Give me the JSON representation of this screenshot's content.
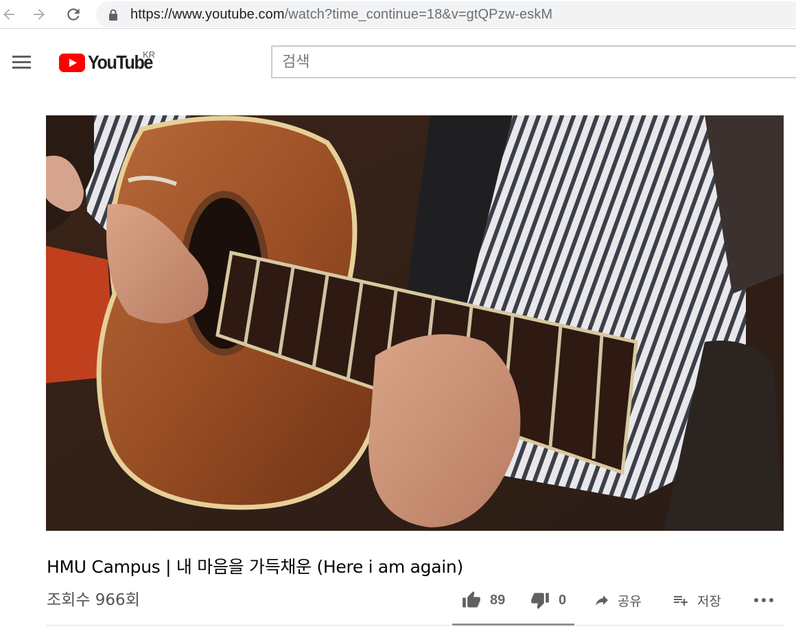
{
  "browser": {
    "url_host": "https://www.youtube.com",
    "url_path": "/watch?time_continue=18&v=gtQPzw-eskM",
    "icons": [
      "back-arrow-icon",
      "forward-arrow-icon",
      "reload-icon",
      "lock-icon"
    ]
  },
  "masthead": {
    "logo_text": "YouTube",
    "region": "KR",
    "search_placeholder": "검색",
    "brand_color": "#ff0000",
    "icons": [
      "hamburger-menu-icon",
      "youtube-play-logo-icon"
    ]
  },
  "video": {
    "title": "HMU Campus | 내 마음을 가득채운 (Here i am again)",
    "views": "조회수 966회"
  },
  "actions": {
    "likes": "89",
    "dislikes": "0",
    "share_label": "공유",
    "save_label": "저장",
    "icons": [
      "thumbs-up-icon",
      "thumbs-down-icon",
      "share-arrow-icon",
      "playlist-add-icon",
      "more-dots-icon"
    ]
  }
}
